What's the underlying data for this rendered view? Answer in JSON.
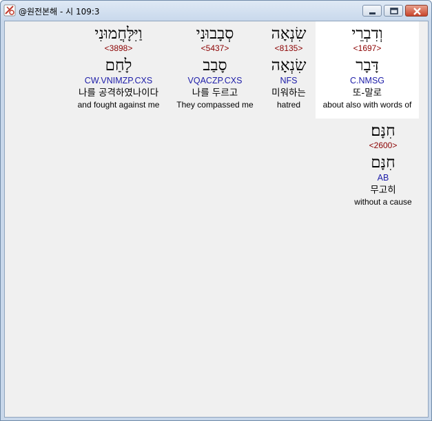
{
  "window": {
    "title": "@원전본해 - 시 109:3",
    "controls": {
      "minimize_icon": "minimize-icon",
      "maximize_icon": "maximize-icon",
      "close_icon": "close-icon"
    }
  },
  "words": [
    {
      "hebrew": "וְדִבְרֵי",
      "strong": "<1697>",
      "lemma": "דָּבָר",
      "morph": "C.NMSG",
      "korean": "또-말로",
      "english": "about also with words of",
      "highlighted": true
    },
    {
      "hebrew": "שִׂנְאָה",
      "strong": "<8135>",
      "lemma": "שִׂנְאָה",
      "morph": "NFS",
      "korean": "미워하는",
      "english": "hatred",
      "highlighted": false
    },
    {
      "hebrew": "סְבָבוּנִי",
      "strong": "<5437>",
      "lemma": "סָבַב",
      "morph": "VQACZP.CXS",
      "korean": "나를 두르고",
      "english": "They compassed me",
      "highlighted": false
    },
    {
      "hebrew": "וַיִּלָּחֲמוּנִי",
      "strong": "<3898>",
      "lemma": "לָחַם",
      "morph": "CW.VNIMZP.CXS",
      "korean": "나를 공격하였나이다",
      "english": "and fought against me",
      "highlighted": false
    },
    {
      "hebrew": "חִנָּם׃",
      "strong": "<2600>",
      "lemma": "חִנָּם",
      "morph": "AB",
      "korean": "무고히",
      "english": "without a cause",
      "highlighted": false
    }
  ]
}
